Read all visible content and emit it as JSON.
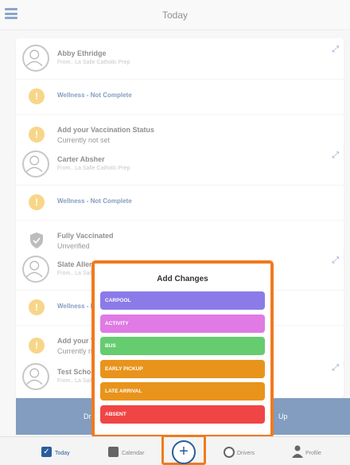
{
  "header": {
    "title": "Today"
  },
  "students": [
    {
      "name": "Abby Ethridge",
      "from": "From.. La Salle Catholic Prep",
      "wellness": "Wellness - Not Complete",
      "vaccine_title": "Add your Vaccination Status",
      "vaccine_sub": "Currently not set"
    },
    {
      "name": "Carter Absher",
      "from": "From.. La Salle Catholic Prep",
      "wellness": "Wellness - Not Complete",
      "vaccine_title": "Fully Vaccinated",
      "vaccine_sub": "Unverified"
    },
    {
      "name": "Slate Allen",
      "from": "From.. La Salle",
      "wellness": "Wellness - N",
      "vaccine_title": "Add your V",
      "vaccine_sub": "Currently n"
    },
    {
      "name": "Test School",
      "from": "From.. La Salle"
    }
  ],
  "action_bar": {
    "left_text": "Dr",
    "right_text": "Up"
  },
  "modal": {
    "title": "Add Changes",
    "options": [
      {
        "label": "CARPOOL",
        "color": "#8b7be8"
      },
      {
        "label": "ACTIVITY",
        "color": "#e07ae4"
      },
      {
        "label": "BUS",
        "color": "#66cc70"
      },
      {
        "label": "EARLY PICKUP",
        "color": "#e8941c"
      },
      {
        "label": "LATE ARRIVAL",
        "color": "#e8941c"
      },
      {
        "label": "ABSENT",
        "color": "#f04545"
      }
    ]
  },
  "nav": {
    "today": "Today",
    "calendar": "Calendar",
    "add": "+",
    "drivers": "Drivers",
    "profile": "Profile"
  },
  "colors": {
    "accent": "#f07a1e",
    "brand": "#1d4d8c"
  }
}
